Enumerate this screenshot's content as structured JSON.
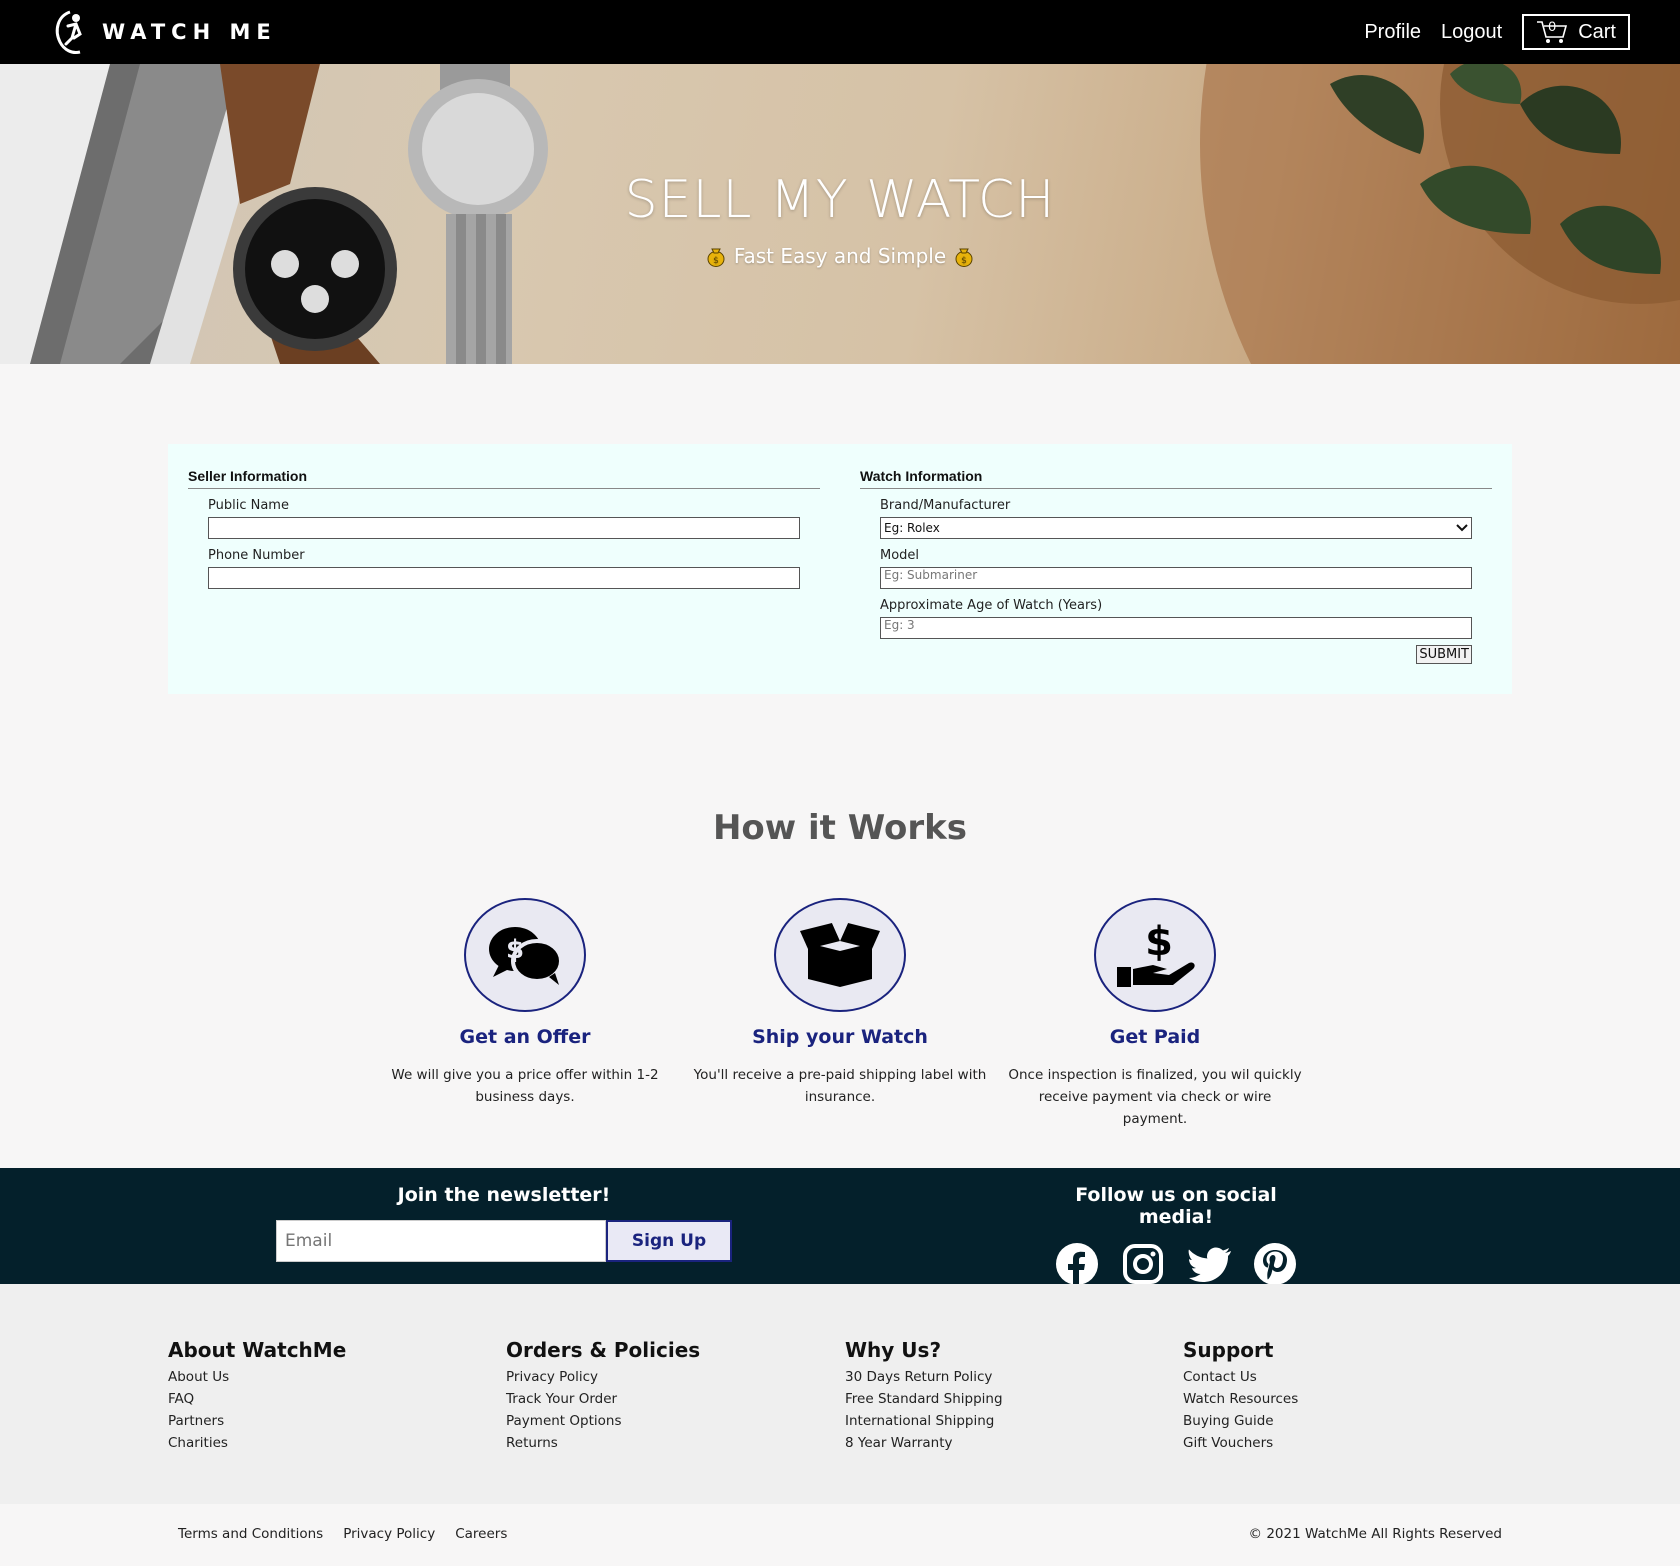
{
  "nav": {
    "brand": "WATCH ME",
    "profile": "Profile",
    "logout": "Logout",
    "cart_count": "0",
    "cart_label": "Cart"
  },
  "hero": {
    "title": "SELL MY WATCH",
    "subtitle": "Fast Easy and Simple"
  },
  "form": {
    "seller": {
      "legend": "Seller Information",
      "public_name_label": "Public Name",
      "public_name_value": "",
      "phone_label": "Phone Number",
      "phone_value": ""
    },
    "watch": {
      "legend": "Watch Information",
      "brand_label": "Brand/Manufacturer",
      "brand_selected": "Eg: Rolex",
      "model_label": "Model",
      "model_placeholder": "Eg: Submariner",
      "age_label": "Approximate Age of Watch (Years)",
      "age_placeholder": "Eg: 3"
    },
    "submit": "SUBMIT"
  },
  "how": {
    "title": "How it Works",
    "steps": [
      {
        "icon": "offer-chat-icon",
        "title": "Get an Offer",
        "desc": "We will give you a price offer within 1-2 business days."
      },
      {
        "icon": "box-icon",
        "title": "Ship your Watch",
        "desc": "You'll receive a pre-paid shipping label with insurance."
      },
      {
        "icon": "hand-dollar-icon",
        "title": "Get Paid",
        "desc": "Once inspection is finalized, you wil quickly receive payment via check or wire payment."
      }
    ]
  },
  "newsletter": {
    "title": "Join the newsletter!",
    "email_placeholder": "Email",
    "signup": "Sign Up"
  },
  "social": {
    "title": "Follow us on social media!",
    "icons": [
      "facebook-icon",
      "instagram-icon",
      "twitter-icon",
      "pinterest-icon"
    ]
  },
  "footer": {
    "columns": [
      {
        "title": "About WatchMe",
        "links": [
          "About Us",
          "FAQ",
          "Partners",
          "Charities"
        ]
      },
      {
        "title": "Orders & Policies",
        "links": [
          "Privacy Policy",
          "Track Your Order",
          "Payment Options",
          "Returns"
        ]
      },
      {
        "title": "Why Us?",
        "links": [
          "30 Days Return Policy",
          "Free Standard Shipping",
          "International Shipping",
          "8 Year Warranty"
        ]
      },
      {
        "title": "Support",
        "links": [
          "Contact Us",
          "Watch Resources",
          "Buying Guide",
          "Gift Vouchers"
        ]
      }
    ],
    "bottom_links": [
      "Terms and Conditions",
      "Privacy Policy",
      "Careers"
    ],
    "copyright": "© 2021 WatchMe All Rights Reserved"
  },
  "colors": {
    "accent": "#1a237e",
    "navbar": "#000000",
    "newsletter_bg": "#04202b",
    "form_bg": "#effffd"
  }
}
